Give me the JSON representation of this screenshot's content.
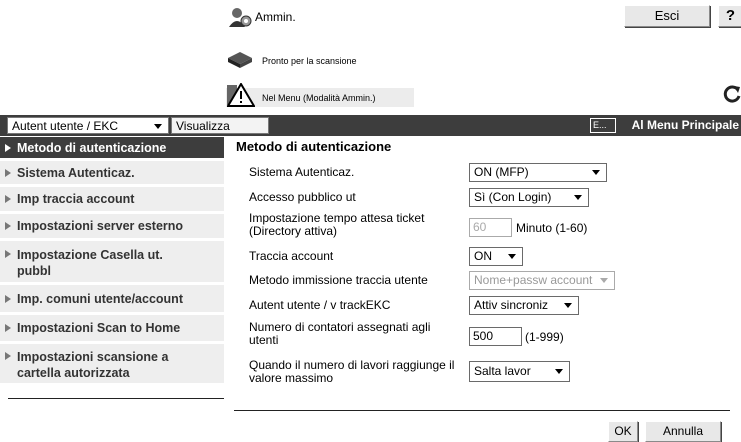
{
  "header": {
    "user_label": "Ammin.",
    "logout_label": "Esci",
    "help_label": "?",
    "status_scan": "Pronto per la scansione",
    "status_mode": "Nel Menu (Modalità Ammin.)"
  },
  "toolbar": {
    "selector_value": "Autent utente / EKC",
    "view_label": "Visualizza",
    "main_menu_label": "Al Menu Principale"
  },
  "sidebar": {
    "items": [
      {
        "label": "Metodo di autenticazione"
      },
      {
        "label": "Sistema Autenticaz."
      },
      {
        "label": "Imp traccia account"
      },
      {
        "label": "Impostazioni server esterno"
      },
      {
        "label": "Impostazione Casella ut. pubbl"
      },
      {
        "label": "Imp. comuni utente/account"
      },
      {
        "label": "Impostazioni Scan to Home"
      },
      {
        "label": "Impostazioni scansione a cartella autorizzata"
      }
    ]
  },
  "main": {
    "title": "Metodo di autenticazione",
    "fields": [
      {
        "label": "Sistema Autenticaz.",
        "value": "ON (MFP)"
      },
      {
        "label": "Accesso pubblico ut",
        "value": "Sì (Con Login)"
      },
      {
        "label": "Impostazione tempo attesa ticket (Directory attiva)",
        "value": "60",
        "unit": "Minuto (1-60)"
      },
      {
        "label": "Traccia account",
        "value": "ON"
      },
      {
        "label": "Metodo immissione traccia utente",
        "value": "Nome+passw account"
      },
      {
        "label": "Autent utente / v trackEKC",
        "value": "Attiv sincroniz"
      },
      {
        "label": "Numero di contatori assegnati agli utenti",
        "value": "500",
        "unit": "(1-999)"
      },
      {
        "label": "Quando il numero di lavori raggiunge il valore massimo",
        "value": "Salta lavor"
      }
    ]
  },
  "footer": {
    "ok_label": "OK",
    "cancel_label": "Annulla"
  }
}
